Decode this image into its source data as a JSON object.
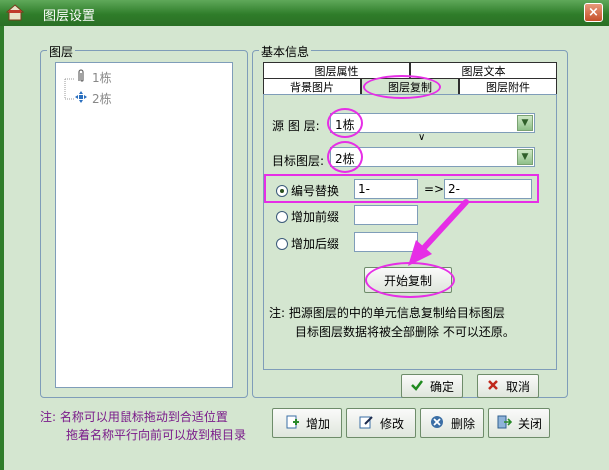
{
  "window": {
    "title": "图层设置",
    "close_label": "×"
  },
  "left_panel": {
    "group_title": "图层",
    "tree_items": [
      "1栋",
      "2栋"
    ],
    "note_lines": [
      "注: 名称可以用鼠标拖动到合适位置",
      "拖着名称平行向前可以放到根目录"
    ]
  },
  "right_panel": {
    "group_title": "基本信息",
    "tabs_top": [
      "图层属性",
      "图层文本"
    ],
    "tabs_bottom": [
      "背景图片",
      "图层复制",
      "图层附件"
    ],
    "active_tab": "图层复制",
    "source_label": "源 图 层:",
    "source_value": "1栋",
    "dir_mark": "∨",
    "target_label": "目标图层:",
    "target_value": "2栋",
    "options": [
      {
        "label": "编号替换",
        "checked": true
      },
      {
        "label": "增加前缀",
        "checked": false
      },
      {
        "label": "增加后缀",
        "checked": false
      }
    ],
    "replace_from": "1-",
    "replace_arrow": "=>",
    "replace_to": "2-",
    "start_copy_label": "开始复制",
    "note_line1": "注: 把源图层的中的单元信息复制给目标图层",
    "note_line2": "目标图层数据将被全部删除 不可以还原。"
  },
  "dialog_buttons": {
    "ok_label": "确定",
    "cancel_label": "取消"
  },
  "bottom_toolbar": [
    "增加",
    "修改",
    "删除",
    "关闭"
  ],
  "colors": {
    "highlight": "#e62ee6",
    "title_bar": "#2f7d2a",
    "background": "#d4e6d0"
  }
}
